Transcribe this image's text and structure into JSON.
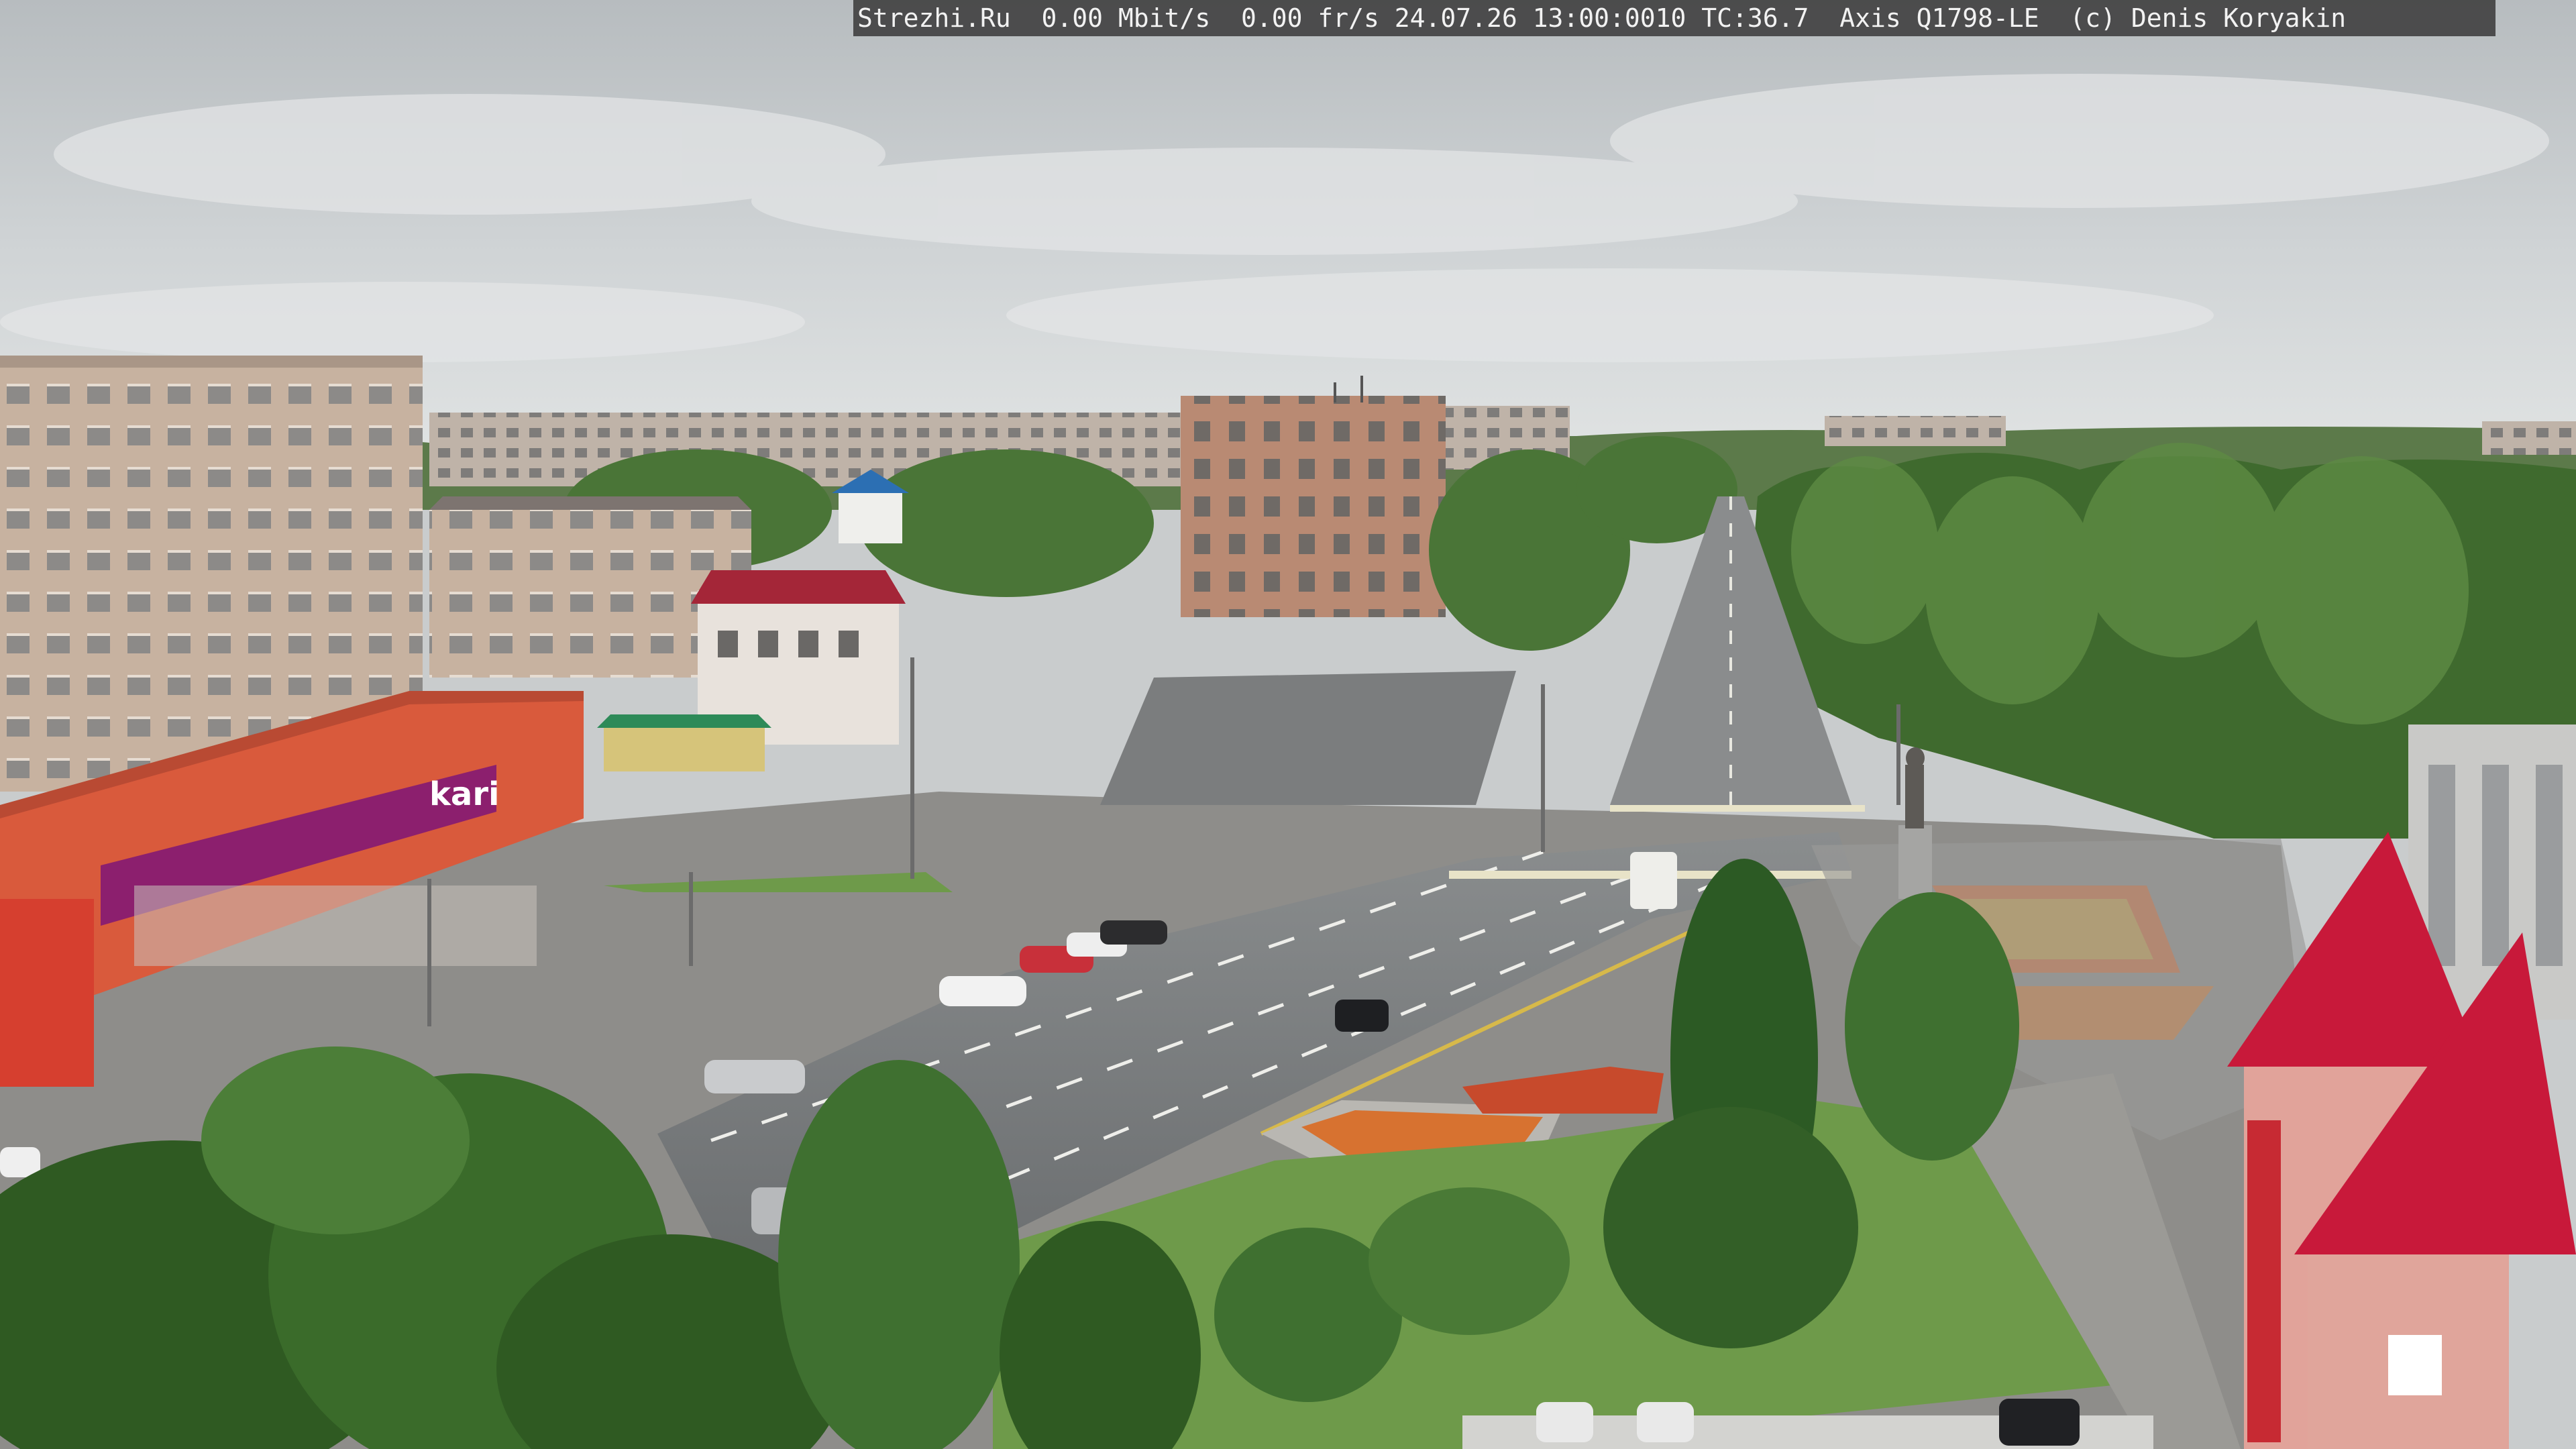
{
  "camera_overlay": {
    "text": "Strezhi.Ru  0.00 Mbit/s  0.00 fr/s 24.07.26 13:00:0010 TC:36.7  Axis Q1798-LE  (c) Denis Koryakin"
  },
  "signage": {
    "store_logo": "kari"
  },
  "colors": {
    "sky": "#c9cccd",
    "store_facade": "#e2603f",
    "store_banner": "#8c1f6e",
    "roof_red": "#c8193a",
    "asphalt": "#6d7072",
    "grass": "#6e9a4a",
    "tree_dark": "#3f6a2e"
  }
}
